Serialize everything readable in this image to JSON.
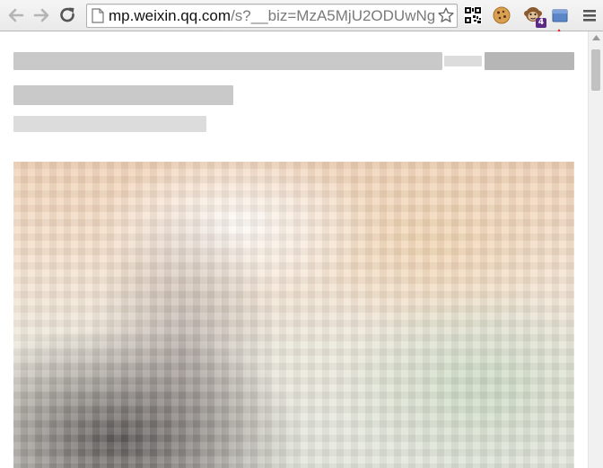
{
  "toolbar": {
    "url_host": "mp.weixin.qq.com",
    "url_path": "/s?__biz=MzA5MjU2ODUwNg",
    "extension_badge": "4",
    "icons": [
      "back-arrow-icon",
      "forward-arrow-icon",
      "reload-icon",
      "page-icon",
      "star-icon",
      "qr-code-icon",
      "cookie-icon",
      "monkey-icon",
      "box-icon",
      "hamburger-menu-icon"
    ]
  },
  "colors": {
    "toolbar_bg": "#ececec",
    "badge_bg": "#5b2a86",
    "annotation_arrow": "#e21b1b",
    "blurred_text": "#c9c9c9"
  }
}
